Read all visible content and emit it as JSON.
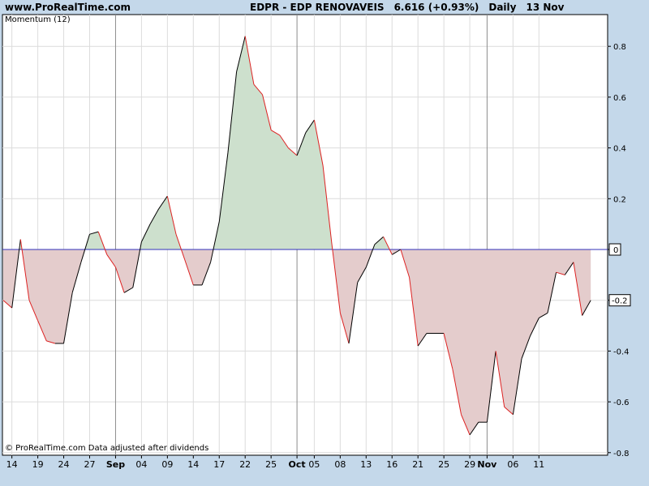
{
  "header": {
    "site": "www.ProRealTime.com",
    "symbol": "EDPR - EDP RENOVAVEIS",
    "price": "6.616 (+0.93%)",
    "period": "Daily",
    "date": "13 Nov"
  },
  "indicator_label": "Momentum (12)",
  "credit": "© ProRealTime.com  Data adjusted after dividends",
  "colors": {
    "positive_fill": "#cde0cd",
    "negative_fill": "#e4cccc",
    "zero_line": "#3333bb",
    "up_segment": "#000000",
    "down_segment": "#dd2222",
    "grid": "#dcdcdc",
    "month_line": "#8c8c8c",
    "background": "#c4d8ea",
    "panel": "#ffffff"
  },
  "chart_data": {
    "type": "area",
    "title": "Momentum (12)",
    "ylim": [
      -0.8,
      0.9
    ],
    "yticks": [
      0.8,
      0.6,
      0.4,
      0.2,
      0,
      -0.2,
      -0.4,
      -0.6,
      -0.8
    ],
    "yticklabels": [
      "0.8",
      "0.6",
      "0.4",
      "0.2",
      "0",
      "-0.2",
      "-0.4",
      "-0.6",
      "-0.8"
    ],
    "current_value_label": "-0.2",
    "grid": true,
    "x_labels": [
      {
        "label": "14",
        "index": 1
      },
      {
        "label": "19",
        "index": 4
      },
      {
        "label": "24",
        "index": 7
      },
      {
        "label": "27",
        "index": 10
      },
      {
        "label": "Sep",
        "index": 13,
        "month": true
      },
      {
        "label": "04",
        "index": 16
      },
      {
        "label": "09",
        "index": 19
      },
      {
        "label": "14",
        "index": 22
      },
      {
        "label": "17",
        "index": 25
      },
      {
        "label": "22",
        "index": 28
      },
      {
        "label": "25",
        "index": 31
      },
      {
        "label": "Oct",
        "index": 34,
        "month": true
      },
      {
        "label": "05",
        "index": 36
      },
      {
        "label": "08",
        "index": 39
      },
      {
        "label": "13",
        "index": 42
      },
      {
        "label": "16",
        "index": 45
      },
      {
        "label": "21",
        "index": 48
      },
      {
        "label": "25",
        "index": 51
      },
      {
        "label": "29",
        "index": 54
      },
      {
        "label": "Nov",
        "index": 56,
        "month": true
      },
      {
        "label": "06",
        "index": 59
      },
      {
        "label": "11",
        "index": 62
      }
    ],
    "series": [
      {
        "values": [
          -0.2,
          -0.23,
          0.04,
          -0.2,
          -0.28,
          -0.36,
          -0.37,
          -0.37,
          -0.17,
          -0.05,
          0.06,
          0.07,
          -0.02,
          -0.07,
          -0.17,
          -0.15,
          0.03,
          0.1,
          0.16,
          0.21,
          0.06,
          -0.04,
          -0.14,
          -0.14,
          -0.05,
          0.11,
          0.38,
          0.7,
          0.84,
          0.65,
          0.61,
          0.47,
          0.45,
          0.4,
          0.37,
          0.46,
          0.51,
          0.33,
          0.03,
          -0.25,
          -0.37,
          -0.13,
          -0.07,
          0.02,
          0.05,
          -0.02,
          0.0,
          -0.11,
          -0.38,
          -0.33,
          -0.33,
          -0.33,
          -0.47,
          -0.65,
          -0.73,
          -0.68,
          -0.68,
          -0.4,
          -0.62,
          -0.65,
          -0.43,
          -0.34,
          -0.27,
          -0.25,
          -0.09,
          -0.1,
          -0.05,
          -0.26,
          -0.2
        ]
      }
    ]
  }
}
